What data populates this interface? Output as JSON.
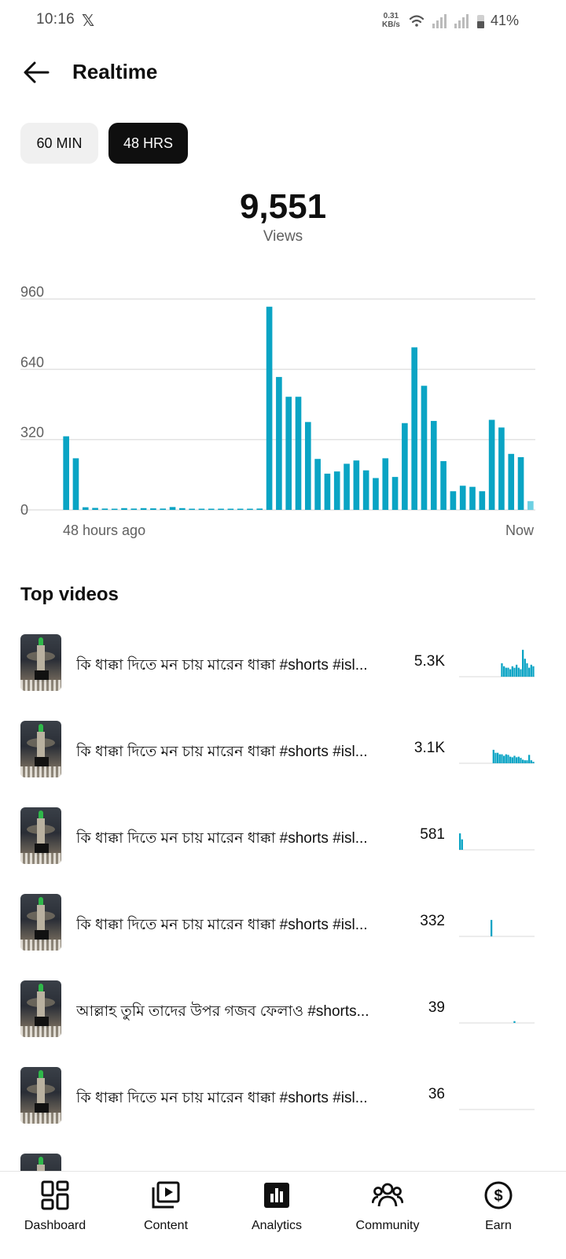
{
  "status_bar": {
    "time": "10:16",
    "x_glyph": "𝕏",
    "speed_value": "0.31",
    "speed_unit": "KB/s",
    "battery_pct": "41%"
  },
  "header": {
    "title": "Realtime",
    "back_icon": "arrow-left-icon"
  },
  "range_tabs": {
    "tab_60": "60 MIN",
    "tab_48": "48 HRS",
    "selected": "48 HRS"
  },
  "summary": {
    "total": "9,551",
    "label": "Views"
  },
  "chart_data": {
    "type": "bar",
    "y_ticks": [
      "960",
      "640",
      "320",
      "0"
    ],
    "y_tick_values": [
      960,
      640,
      320,
      0
    ],
    "ylim": [
      0,
      960
    ],
    "x_start_label": "48 hours ago",
    "x_end_label": "Now",
    "grid": true,
    "bar_color": "#0aa4c4",
    "last_bar_color": "#6dd0e3",
    "values": [
      335,
      235,
      12,
      9,
      6,
      5,
      8,
      6,
      8,
      7,
      6,
      13,
      8,
      3,
      2,
      5,
      5,
      3,
      5,
      3,
      6,
      925,
      605,
      515,
      515,
      400,
      232,
      165,
      175,
      210,
      225,
      180,
      145,
      235,
      150,
      395,
      740,
      565,
      405,
      222,
      85,
      110,
      105,
      85,
      410,
      375,
      255,
      240,
      40
    ]
  },
  "top_videos": {
    "title": "Top videos",
    "items": [
      {
        "title": "কি ধাক্কা দিতে মন চায় মারেন ধাক্কা #shorts #isl...",
        "views": "5.3K",
        "spark": [
          0,
          0,
          0,
          0,
          0,
          0,
          0,
          0,
          0,
          0,
          0,
          0,
          0,
          0,
          0,
          0,
          0,
          0,
          0,
          0,
          0.45,
          0.35,
          0.3,
          0.3,
          0.25,
          0.35,
          0.3,
          0.4,
          0.3,
          0.25,
          0.9,
          0.6,
          0.45,
          0.3,
          0.4,
          0.35
        ]
      },
      {
        "title": "কি ধাক্কা দিতে মন চায় মারেন ধাক্কা #shorts #isl...",
        "views": "3.1K",
        "spark": [
          0,
          0,
          0,
          0,
          0,
          0,
          0,
          0,
          0,
          0,
          0,
          0,
          0,
          0,
          0,
          0,
          0.45,
          0.35,
          0.35,
          0.3,
          0.3,
          0.25,
          0.3,
          0.28,
          0.22,
          0.2,
          0.25,
          0.2,
          0.22,
          0.18,
          0.12,
          0.1,
          0.1,
          0.28,
          0.1,
          0.05
        ]
      },
      {
        "title": "কি ধাক্কা দিতে মন চায় মারেন ধাক্কা #shorts #isl...",
        "views": "581",
        "spark": [
          0.55,
          0.35,
          0,
          0,
          0,
          0,
          0,
          0,
          0,
          0,
          0,
          0,
          0,
          0,
          0,
          0,
          0,
          0,
          0,
          0,
          0,
          0,
          0,
          0,
          0,
          0,
          0,
          0,
          0,
          0,
          0,
          0,
          0,
          0,
          0,
          0
        ]
      },
      {
        "title": "কি ধাক্কা দিতে মন চায় মারেন ধাক্কা #shorts #isl...",
        "views": "332",
        "spark": [
          0,
          0,
          0,
          0,
          0,
          0,
          0,
          0,
          0,
          0,
          0,
          0,
          0,
          0,
          0,
          0.55,
          0,
          0,
          0,
          0,
          0,
          0,
          0,
          0,
          0,
          0,
          0,
          0,
          0,
          0,
          0,
          0,
          0,
          0,
          0,
          0
        ]
      },
      {
        "title": "আল্লাহ তুমি তাদের উপর গজব ফেলাও #shorts...",
        "views": "39",
        "spark": [
          0,
          0,
          0,
          0,
          0,
          0,
          0,
          0,
          0,
          0,
          0,
          0,
          0,
          0,
          0,
          0,
          0,
          0,
          0,
          0,
          0,
          0,
          0,
          0,
          0,
          0,
          0.06,
          0,
          0,
          0,
          0,
          0,
          0,
          0,
          0,
          0
        ]
      },
      {
        "title": "কি ধাক্কা দিতে মন চায় মারেন ধাক্কা #shorts #isl...",
        "views": "36",
        "spark": [
          0,
          0,
          0,
          0,
          0,
          0,
          0,
          0,
          0,
          0,
          0,
          0,
          0,
          0,
          0,
          0,
          0,
          0,
          0,
          0,
          0,
          0,
          0,
          0,
          0,
          0,
          0,
          0,
          0,
          0,
          0,
          0,
          0,
          0,
          0,
          0
        ]
      }
    ]
  },
  "bottom_nav": {
    "items": [
      {
        "label": "Dashboard",
        "icon": "dashboard-icon"
      },
      {
        "label": "Content",
        "icon": "content-icon"
      },
      {
        "label": "Analytics",
        "icon": "analytics-icon",
        "active": true
      },
      {
        "label": "Community",
        "icon": "community-icon"
      },
      {
        "label": "Earn",
        "icon": "earn-icon"
      }
    ]
  }
}
